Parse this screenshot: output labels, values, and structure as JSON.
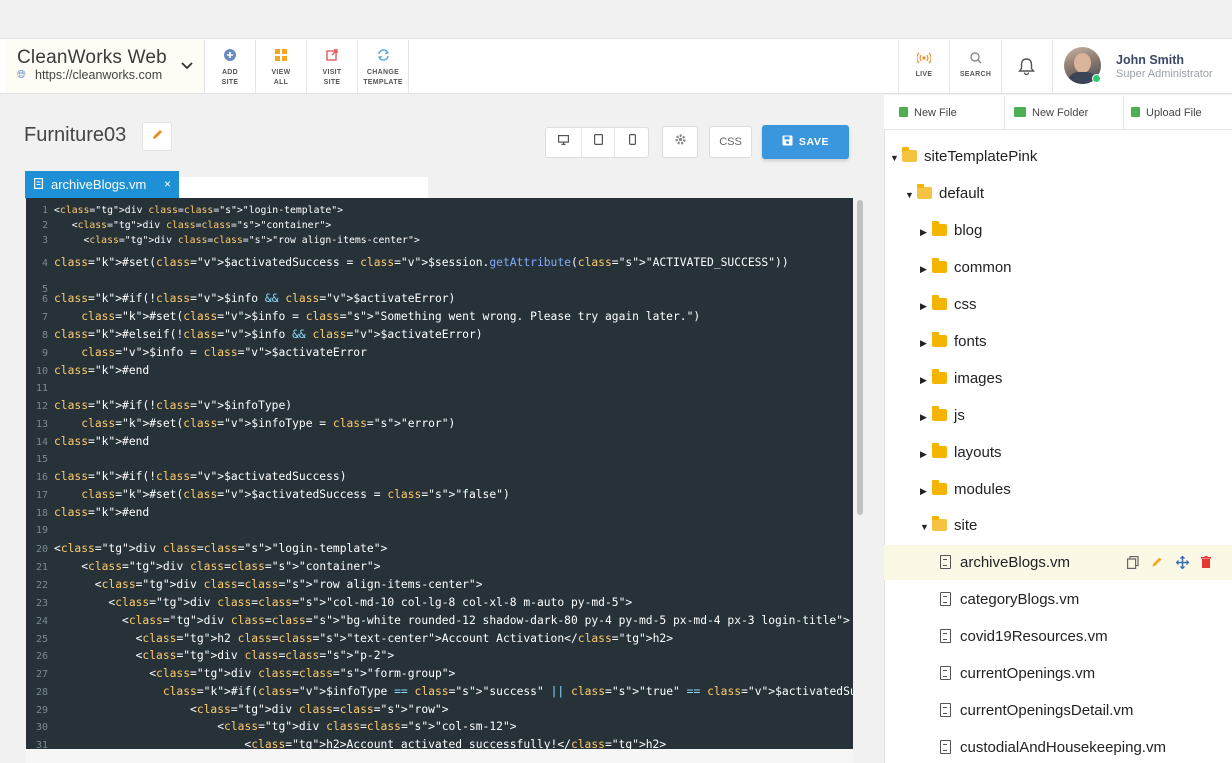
{
  "header": {
    "site_name": "CleanWorks Web",
    "site_url": "https://cleanworks.com",
    "actions": [
      {
        "label_1": "ADD",
        "label_2": "SITE",
        "icon": "plus-circle-icon",
        "color": "#6a8bc0"
      },
      {
        "label_1": "VIEW",
        "label_2": "ALL",
        "icon": "grid-icon",
        "color": "#f5a623"
      },
      {
        "label_1": "VISIT",
        "label_2": "SITE",
        "icon": "external-link-icon",
        "color": "#e05a5a"
      },
      {
        "label_1": "CHANGE",
        "label_2": "TEMPLATE",
        "icon": "refresh-icon",
        "color": "#5aa6d6"
      }
    ],
    "live_label": "LIVE",
    "search_label": "SEARCH",
    "user": {
      "name": "John Smith",
      "role": "Super Administrator"
    }
  },
  "editor": {
    "page_title": "Furniture03",
    "css_label": "CSS",
    "save_label": "SAVE",
    "tab_label": "archiveBlogs.vm",
    "tab_close": "×",
    "colors": {
      "background": "#263238",
      "keyword": "#c792ea",
      "variable": "#ffcb6b",
      "string": "#c3e88d",
      "accent": "#3a96dd"
    }
  },
  "code_lines": [
    {
      "n": "1",
      "t": "<div class=\"login-template\">"
    },
    {
      "n": "2",
      "t": "   <div class=\"container\">"
    },
    {
      "n": "3",
      "t": "     <div class=\"row align-items-center\">"
    },
    {
      "n": "4",
      "t": "#set($activatedSuccess = $session.getAttribute(\"ACTIVATED_SUCCESS\"))"
    },
    {
      "n": "5",
      "t": ""
    },
    {
      "n": "6",
      "t": "#if(!$info && $activateError)"
    },
    {
      "n": "7",
      "t": "    #set($info = \"Something went wrong. Please try again later.\")"
    },
    {
      "n": "8",
      "t": "#elseif(!$info && $activateError)"
    },
    {
      "n": "9",
      "t": "    $info = $activateError"
    },
    {
      "n": "10",
      "t": "#end"
    },
    {
      "n": "11",
      "t": ""
    },
    {
      "n": "12",
      "t": "#if(!$infoType)"
    },
    {
      "n": "13",
      "t": "    #set($infoType = \"error\")"
    },
    {
      "n": "14",
      "t": "#end"
    },
    {
      "n": "15",
      "t": ""
    },
    {
      "n": "16",
      "t": "#if(!$activatedSuccess)"
    },
    {
      "n": "17",
      "t": "    #set($activatedSuccess = \"false\")"
    },
    {
      "n": "18",
      "t": "#end"
    },
    {
      "n": "19",
      "t": ""
    },
    {
      "n": "20",
      "t": "<div class=\"login-template\">"
    },
    {
      "n": "21",
      "t": "    <div class=\"container\">"
    },
    {
      "n": "22",
      "t": "      <div class=\"row align-items-center\">"
    },
    {
      "n": "23",
      "t": "        <div class=\"col-md-10 col-lg-8 col-xl-8 m-auto py-md-5\">"
    },
    {
      "n": "24",
      "t": "          <div class=\"bg-white rounded-12 shadow-dark-80 py-4 py-md-5 px-md-4 px-3 login-title\">"
    },
    {
      "n": "25",
      "t": "            <h2 class=\"text-center\">Account Activation</h2>"
    },
    {
      "n": "26",
      "t": "            <div class=\"p-2\">"
    },
    {
      "n": "27",
      "t": "              <div class=\"form-group\">"
    },
    {
      "n": "28",
      "t": "                #if($infoType == \"success\" || \"true\" == $activatedSuccess)"
    },
    {
      "n": "29",
      "t": "                    <div class=\"row\">"
    },
    {
      "n": "30",
      "t": "                        <div class=\"col-sm-12\">"
    },
    {
      "n": "31",
      "t": "                            <h2>Account activated successfully!</h2>"
    }
  ],
  "file_panel": {
    "new_file": "New File",
    "new_folder": "New Folder",
    "upload_file": "Upload File",
    "root": "siteTemplatePink",
    "default_folder": "default",
    "folders": [
      "blog",
      "common",
      "css",
      "fonts",
      "images",
      "js",
      "layouts",
      "modules"
    ],
    "site_folder": "site",
    "files": [
      "archiveBlogs.vm",
      "categoryBlogs.vm",
      "covid19Resources.vm",
      "currentOpenings.vm",
      "currentOpeningsDetail.vm",
      "custodialAndHousekeeping.vm"
    ]
  }
}
